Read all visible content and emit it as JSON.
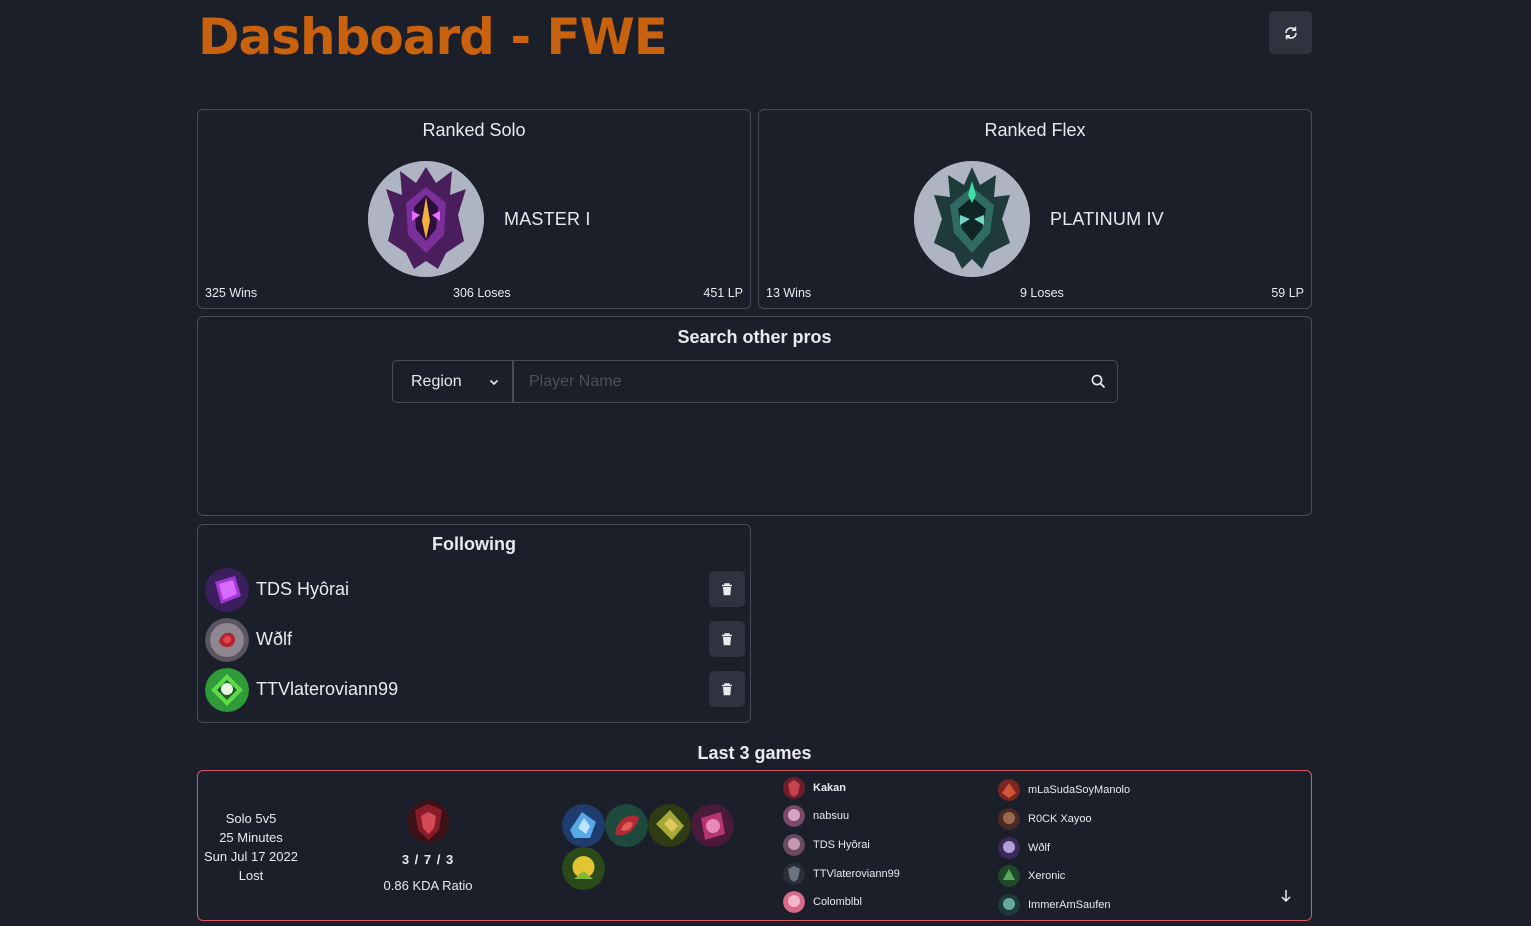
{
  "header": {
    "title": "Dashboard - FWE"
  },
  "ranked_solo": {
    "title": "Ranked Solo",
    "tier": "MASTER I",
    "wins": "325 Wins",
    "losses": "306 Loses",
    "lp": "451 LP",
    "emblem": "master-emblem"
  },
  "ranked_flex": {
    "title": "Ranked Flex",
    "tier": "PLATINUM IV",
    "wins": "13 Wins",
    "losses": "9 Loses",
    "lp": "59 LP",
    "emblem": "platinum-emblem"
  },
  "search": {
    "title": "Search other pros",
    "region_label": "Region",
    "placeholder": "Player Name"
  },
  "following": {
    "title": "Following",
    "players": [
      {
        "name": "TDS Hyôrai"
      },
      {
        "name": "Wðlf"
      },
      {
        "name": "TTVlateroviann99"
      }
    ]
  },
  "last_games": {
    "title": "Last 3 games",
    "games": [
      {
        "mode": "Solo 5v5",
        "duration": "25 Minutes",
        "date": "Sun Jul 17 2022",
        "result": "Lost",
        "kda": "3 / 7 / 3",
        "kda_ratio": "0.86 KDA Ratio",
        "team_1": [
          "Kakan",
          "nabsuu",
          "TDS Hyôrai",
          "TTVlateroviann99",
          "Colomblbl"
        ],
        "team_2": [
          "mLaSudaSoyManolo",
          "R0CK Xayoo",
          "Wðlf",
          "Xeronic",
          "ImmerAmSaufen"
        ]
      }
    ]
  },
  "colors": {
    "background": "#1b1f2a",
    "title": "#c8620e",
    "border": "#454b58",
    "loss_border": "#d55a64"
  }
}
